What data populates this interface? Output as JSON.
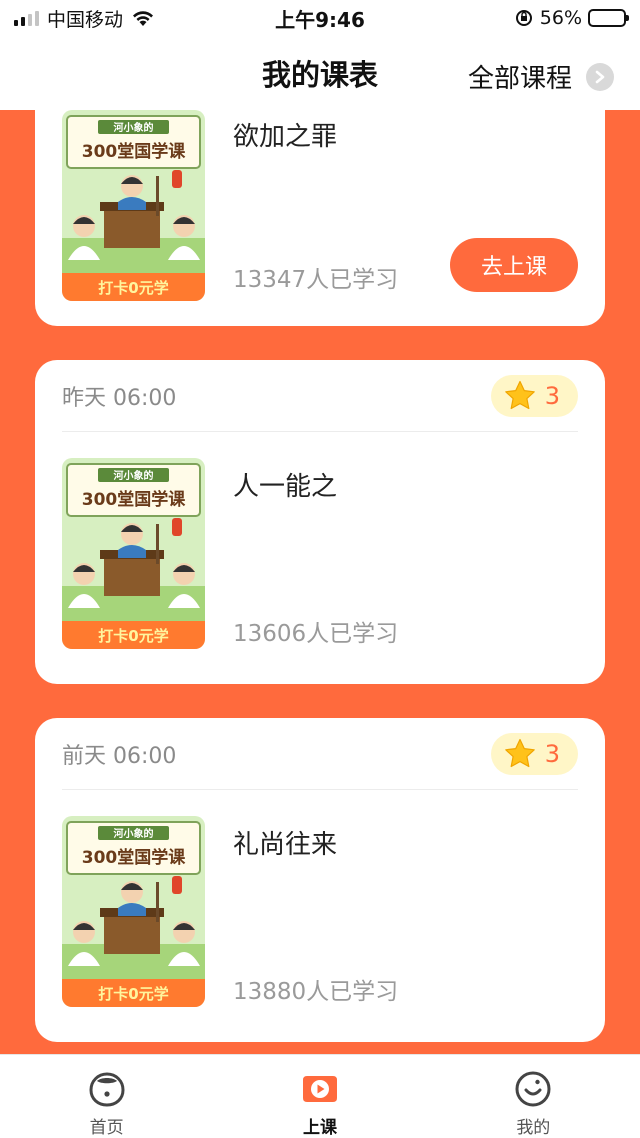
{
  "status_bar": {
    "carrier": "中国移动",
    "time": "上午9:46",
    "battery_percent": "56%",
    "battery_level": 0.56
  },
  "header": {
    "title": "我的课表",
    "all_courses_label": "全部课程"
  },
  "cards": [
    {
      "time": "",
      "stars": "",
      "course_name": "欲加之罪",
      "learners": "13347人已学习",
      "button_label": "去上课",
      "thumb": {
        "tag": "河小象的",
        "title": "300堂国学课",
        "footer": "打卡0元学"
      }
    },
    {
      "time": "昨天 06:00",
      "stars": "3",
      "course_name": "人一能之",
      "learners": "13606人已学习",
      "thumb": {
        "tag": "河小象的",
        "title": "300堂国学课",
        "footer": "打卡0元学"
      }
    },
    {
      "time": "前天 06:00",
      "stars": "3",
      "course_name": "礼尚往来",
      "learners": "13880人已学习",
      "thumb": {
        "tag": "河小象的",
        "title": "300堂国学课",
        "footer": "打卡0元学"
      }
    }
  ],
  "tab_bar": {
    "items": [
      {
        "label": "首页",
        "icon": "home-face-icon"
      },
      {
        "label": "上课",
        "icon": "play-icon"
      },
      {
        "label": "我的",
        "icon": "profile-face-icon"
      }
    ],
    "active_index": 1
  },
  "colors": {
    "accent": "#ff6a3d",
    "star_badge_bg": "#fff6c7",
    "thumb_green": "#d7efc1",
    "thumb_orange": "#ff7a2f"
  }
}
